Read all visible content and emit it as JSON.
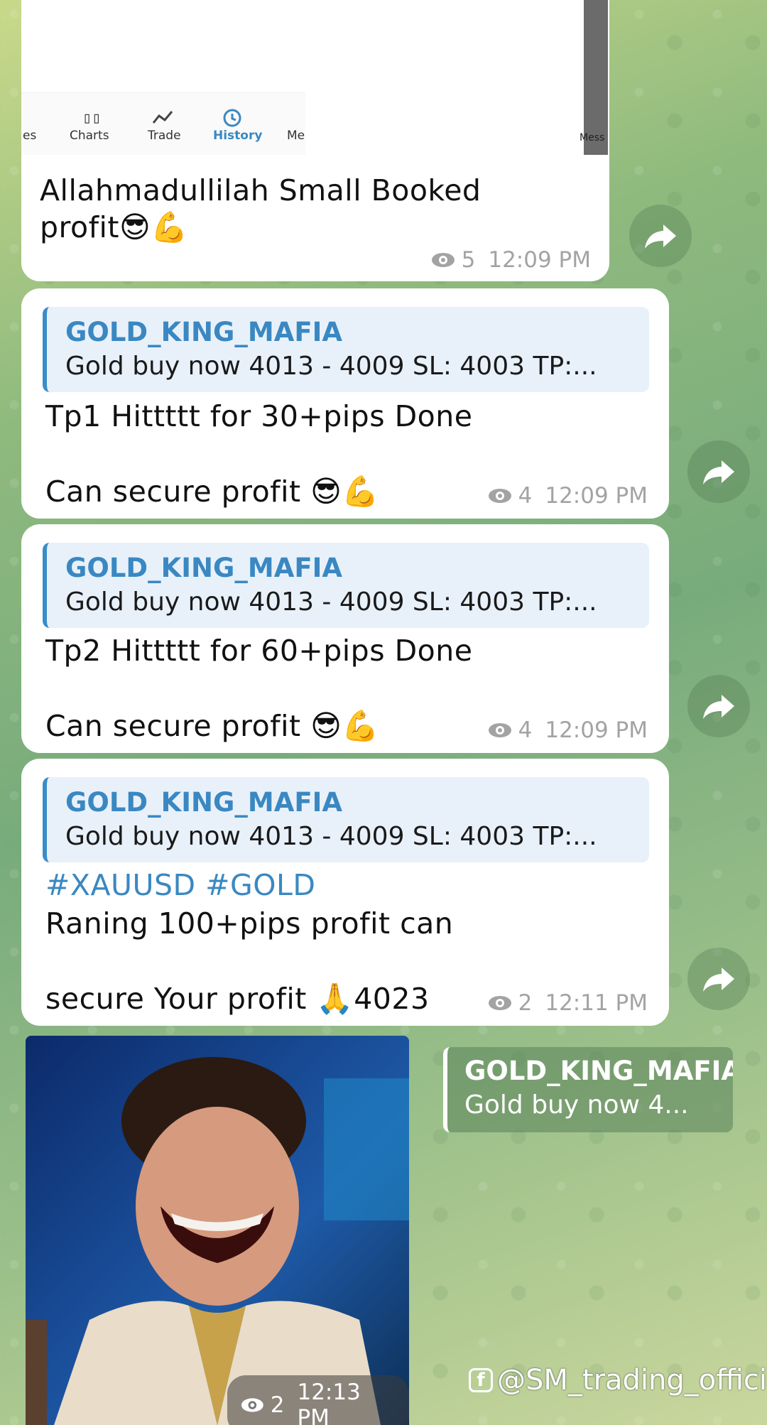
{
  "screenshot_top": {
    "tabs": [
      {
        "label": "es"
      },
      {
        "label": "Charts"
      },
      {
        "label": "Trade"
      },
      {
        "label": "History"
      },
      {
        "label": "Me"
      },
      {
        "label": "Mess"
      }
    ]
  },
  "messages": [
    {
      "line1": "Allahmadullilah Small Booked",
      "line2": "profit",
      "emoji": "😎💪",
      "views": "5",
      "time": "12:09 PM"
    },
    {
      "quote_title": "GOLD_KING_MAFIA",
      "quote_text": "Gold buy now 4013 - 4009  SL: 4003  TP:...",
      "line1": "Tp1 Hittttt for 30+pips Done",
      "line2": "Can  secure profit ",
      "emoji": "😎💪",
      "views": "4",
      "time": "12:09 PM"
    },
    {
      "quote_title": "GOLD_KING_MAFIA",
      "quote_text": "Gold buy now 4013 - 4009  SL: 4003  TP:...",
      "line1": "Tp2 Hittttt for 60+pips Done",
      "line2": "Can  secure profit ",
      "emoji": "😎💪",
      "views": "4",
      "time": "12:09 PM"
    },
    {
      "quote_title": "GOLD_KING_MAFIA",
      "quote_text": "Gold buy now 4013 - 4009  SL: 4003  TP:...",
      "hashtags": "#XAUUSD #GOLD",
      "line1": "Raning 100+pips profit can",
      "line2": "secure Your profit ",
      "emoji": "🙏",
      "line2_suffix": "4023",
      "views": "2",
      "time": "12:11 PM"
    },
    {
      "image_alt": "laughing man photo",
      "quote_title": "GOLD_KING_MAFIA",
      "quote_text": "Gold buy now 4...",
      "views": "2",
      "time": "12:13 PM"
    }
  ],
  "watermark": "@SM_trading_official",
  "colors": {
    "accent": "#3a88c2",
    "bubble": "#ffffff",
    "meta": "#a3a3a3"
  }
}
